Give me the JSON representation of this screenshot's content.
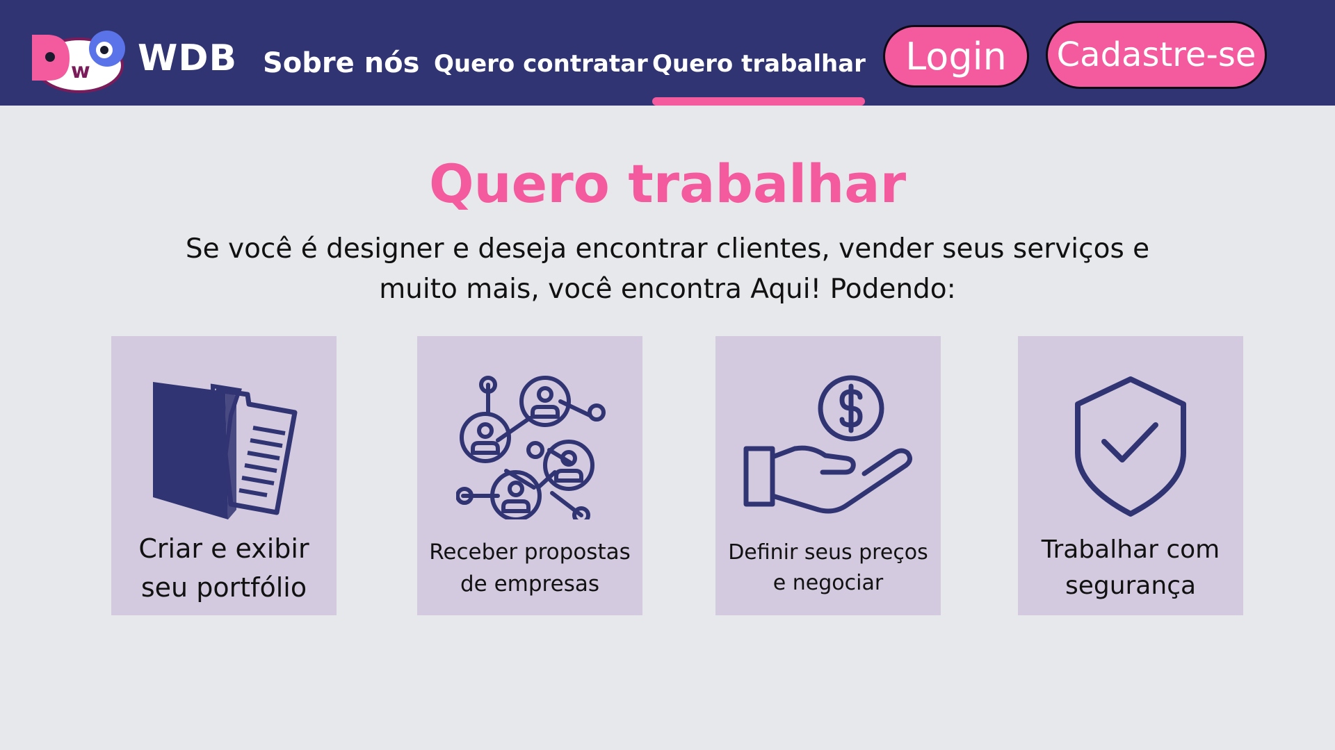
{
  "header": {
    "brand": "WDB",
    "logo_letters": [
      "D",
      "w",
      "O"
    ],
    "nav": [
      {
        "label": "Sobre nós"
      },
      {
        "label": "Quero contratar"
      },
      {
        "label": "Quero trabalhar",
        "active": true
      }
    ],
    "login_label": "Login",
    "signup_label": "Cadastre-se"
  },
  "main": {
    "title": "Quero trabalhar",
    "intro_line1": "Se você é designer e deseja encontrar clientes, vender seus serviços e",
    "intro_line2": "muito mais, você encontra Aqui! Podendo:",
    "cards": [
      {
        "line1": "Criar e exibir",
        "line2": "seu portfólio",
        "icon": "portfolio-folder-icon"
      },
      {
        "line1": "Receber propostas",
        "line2": "de empresas",
        "icon": "network-people-icon"
      },
      {
        "line1": "Definir seus preços",
        "line2": "e negociar",
        "icon": "hand-dollar-coin-icon"
      },
      {
        "line1": "Trabalhar com",
        "line2": "segurança",
        "icon": "shield-check-icon"
      }
    ]
  },
  "colors": {
    "header_bg": "#313473",
    "accent_pink": "#f45b9e",
    "page_bg": "#e7e8ec",
    "card_bg": "#d3cadf",
    "icon_navy": "#313473"
  }
}
